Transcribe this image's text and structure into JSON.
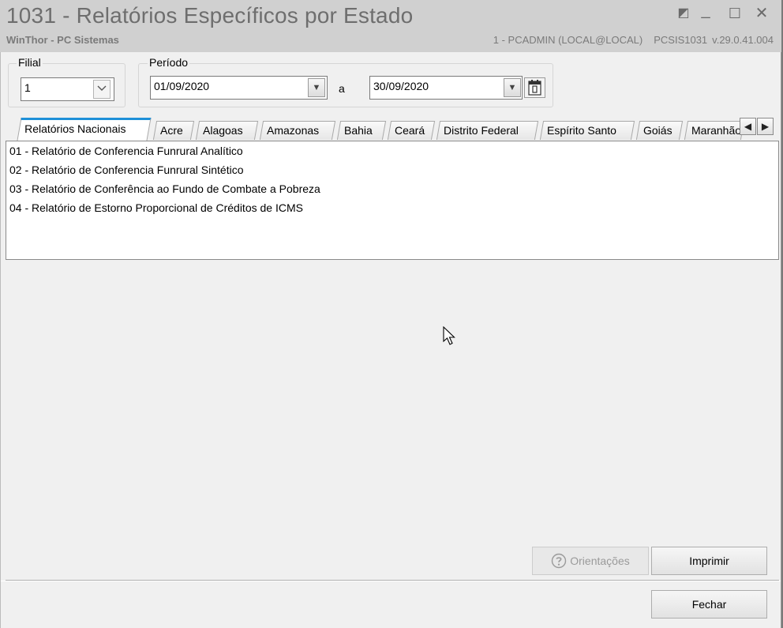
{
  "window": {
    "title": "1031 - Relatórios Específicos por Estado",
    "app_name": "WinThor - PC Sistemas",
    "user": "1 - PCADMIN (LOCAL@LOCAL)",
    "program": "PCSIS1031",
    "version": "v.29.0.41.004",
    "controls": {
      "restore": "◩",
      "minimize": "_",
      "maximize": "☐",
      "close": "✕"
    }
  },
  "filters": {
    "filial_label": "Filial",
    "filial_value": "1",
    "periodo_label": "Período",
    "date_from": "01/09/2020",
    "separator": "a",
    "date_to": "30/09/2020"
  },
  "tabs": [
    {
      "label": "Relatórios Nacionais",
      "active": true
    },
    {
      "label": "Acre"
    },
    {
      "label": "Alagoas"
    },
    {
      "label": "Amazonas"
    },
    {
      "label": "Bahia"
    },
    {
      "label": "Ceará"
    },
    {
      "label": "Distrito Federal"
    },
    {
      "label": "Espírito Santo"
    },
    {
      "label": "Goiás"
    },
    {
      "label": "Maranhão"
    }
  ],
  "reports": [
    "01 - Relatório de Conferencia Funrural Analítico",
    "02 - Relatório de Conferencia Funrural Sintético",
    "03 - Relatório de Conferência ao Fundo de Combate a Pobreza",
    "04 - Relatório de Estorno Proporcional de Créditos de ICMS"
  ],
  "buttons": {
    "orientacoes": "Orientações",
    "imprimir": "Imprimir",
    "fechar": "Fechar"
  }
}
